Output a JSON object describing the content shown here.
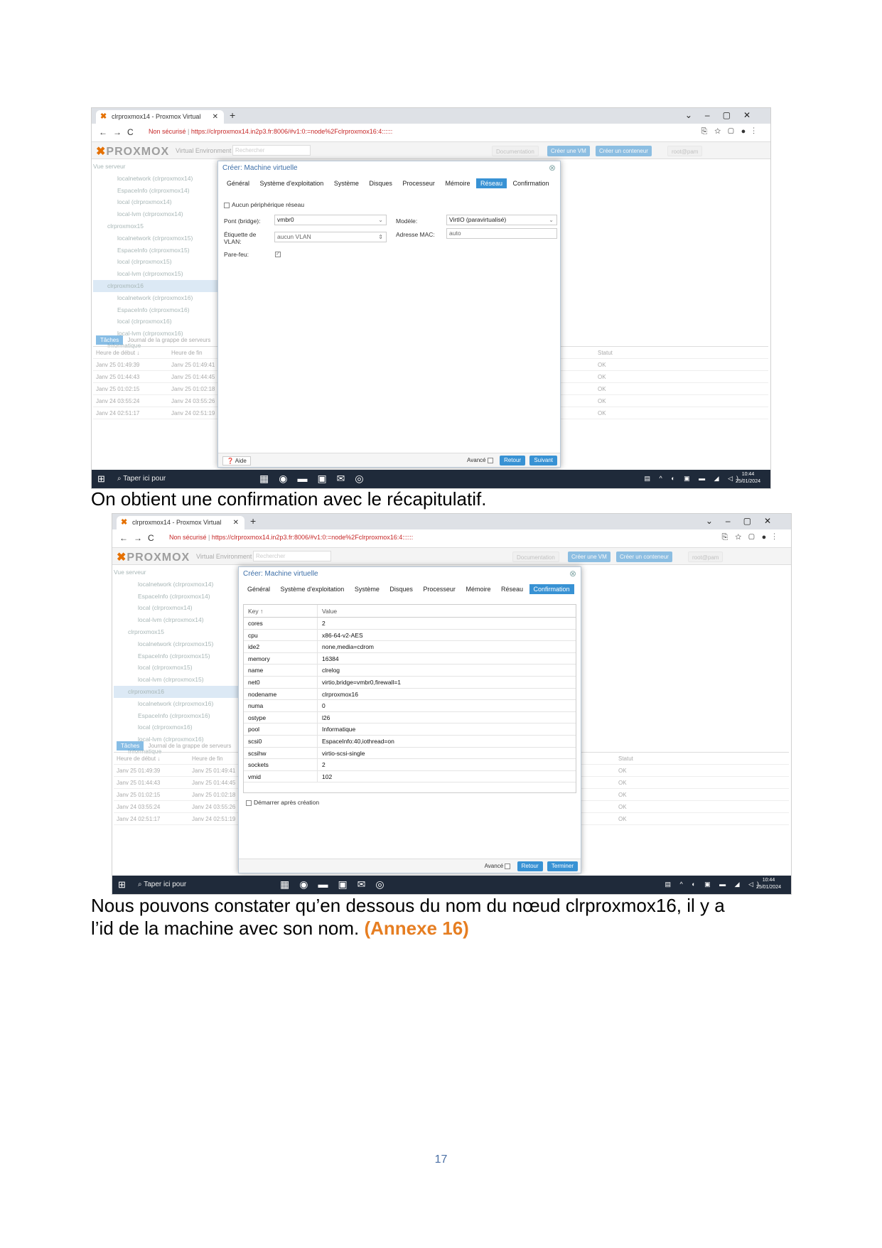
{
  "shot1": {
    "browser": {
      "tab_title": "clrproxmox14 - Proxmox Virtual",
      "url_warning": "Non sécurisé",
      "url": "https://clrproxmox14.in2p3.fr:8006/#v1:0:=node%2Fclrproxmox16:4::::::"
    },
    "pve": {
      "logo": "PROXMOX",
      "env": "Virtual Environment 8.1.4",
      "search_placeholder": "Rechercher",
      "btn_doc": "Documentation",
      "btn_create_vm": "Créer une VM",
      "btn_create_ct": "Créer un conteneur",
      "btn_user": "root@pam"
    },
    "dialog": {
      "title": "Créer: Machine virtuelle",
      "tabs": [
        "Général",
        "Système d'exploitation",
        "Système",
        "Disques",
        "Processeur",
        "Mémoire",
        "Réseau",
        "Confirmation"
      ],
      "active_tab": "Réseau",
      "no_network": "Aucun périphérique réseau",
      "bridge_label": "Pont (bridge):",
      "bridge_value": "vmbr0",
      "vlan_label": "Étiquette de VLAN:",
      "vlan_value": "aucun VLAN",
      "firewall_label": "Pare-feu:",
      "model_label": "Modèle:",
      "model_value": "VirtIO (paravirtualisé)",
      "mac_label": "Adresse MAC:",
      "mac_value": "auto",
      "help": "Aide",
      "advanced": "Avancé",
      "back": "Retour",
      "next": "Suivant"
    }
  },
  "caption1": "On obtient une confirmation avec le récapitulatif.",
  "shot2": {
    "browser": {
      "tab_title": "clrproxmox14 - Proxmox Virtual",
      "url_warning": "Non sécurisé",
      "url": "https://clrproxmox14.in2p3.fr:8006/#v1:0:=node%2Fclrproxmox16:4::::::"
    },
    "pve": {
      "logo": "PROXMOX",
      "env": "Virtual Environment 8.1.4",
      "search_placeholder": "Rechercher",
      "btn_doc": "Documentation",
      "btn_create_vm": "Créer une VM",
      "btn_create_ct": "Créer un conteneur",
      "btn_user": "root@pam"
    },
    "dialog": {
      "title": "Créer: Machine virtuelle",
      "tabs": [
        "Général",
        "Système d'exploitation",
        "Système",
        "Disques",
        "Processeur",
        "Mémoire",
        "Réseau",
        "Confirmation"
      ],
      "active_tab": "Confirmation",
      "col_key": "Key ↑",
      "col_value": "Value",
      "rows": [
        [
          "cores",
          "2"
        ],
        [
          "cpu",
          "x86-64-v2-AES"
        ],
        [
          "ide2",
          "none,media=cdrom"
        ],
        [
          "memory",
          "16384"
        ],
        [
          "name",
          "clrelog"
        ],
        [
          "net0",
          "virtio,bridge=vmbr0,firewall=1"
        ],
        [
          "nodename",
          "clrproxmox16"
        ],
        [
          "numa",
          "0"
        ],
        [
          "ostype",
          "l26"
        ],
        [
          "pool",
          "Informatique"
        ],
        [
          "scsi0",
          "EspaceInfo:40,iothread=on"
        ],
        [
          "scsihw",
          "virtio-scsi-single"
        ],
        [
          "sockets",
          "2"
        ],
        [
          "vmid",
          "102"
        ]
      ],
      "start_after": "Démarrer après création",
      "advanced": "Avancé",
      "back": "Retour",
      "finish": "Terminer"
    }
  },
  "tree": [
    "localnetwork (clrproxmox14)",
    "EspaceInfo (clrproxmox14)",
    "local (clrproxmox14)",
    "local-lvm (clrproxmox14)",
    "clrproxmox15",
    "localnetwork (clrproxmox15)",
    "EspaceInfo (clrproxmox15)",
    "local (clrproxmox15)",
    "local-lvm (clrproxmox15)",
    "clrproxmox16",
    "localnetwork (clrproxmox16)",
    "EspaceInfo (clrproxmox16)",
    "local (clrproxmox16)",
    "local-lvm (clrproxmox16)",
    "Informatique"
  ],
  "tree_header": "Vue serveur",
  "tasks": {
    "tab_tasks": "Tâches",
    "tab_log": "Journal de la grappe de serveurs",
    "col_start": "Heure de début ↓",
    "col_end": "Heure de fin",
    "col_status": "Statut",
    "rows": [
      [
        "Janv 25 01:49:39",
        "Janv 25 01:49:41",
        "OK"
      ],
      [
        "Janv 25 01:44:43",
        "Janv 25 01:44:45",
        "OK"
      ],
      [
        "Janv 25 01:02:15",
        "Janv 25 01:02:18",
        "OK"
      ],
      [
        "Janv 24 03:55:24",
        "Janv 24 03:55:26",
        "OK"
      ],
      [
        "Janv 24 02:51:17",
        "Janv 24 02:51:19",
        "OK"
      ]
    ]
  },
  "taskbar": {
    "search": "Taper ici pour",
    "time": "10:44",
    "date": "25/01/2024"
  },
  "caption2_line1": "Nous pouvons constater qu’en dessous du nom du nœud clrproxmox16, il y a",
  "caption2_line2": "l’id de la machine avec son nom.",
  "annex": "(Annexe 16)",
  "page_number": "17"
}
